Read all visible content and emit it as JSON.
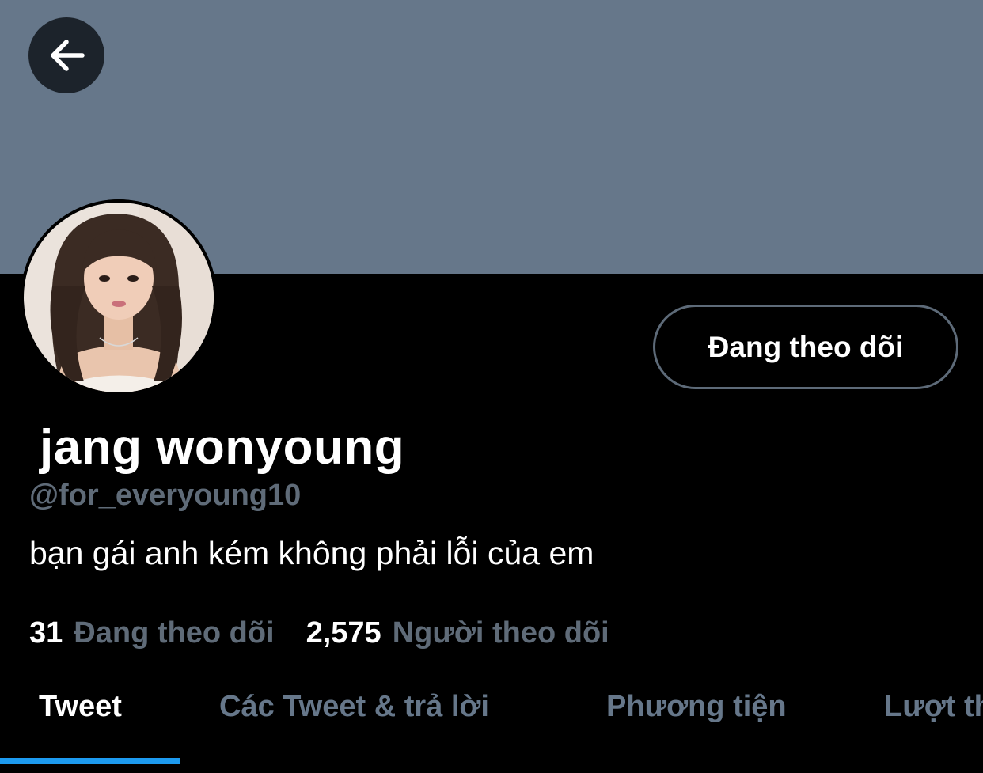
{
  "profile": {
    "display_name": " jang wonyoung",
    "handle": "@for_everyoung10",
    "bio": "bạn gái anh kém không phải lỗi của em",
    "follow_button_label": "Đang theo dõi"
  },
  "stats": {
    "following_count": "31",
    "following_label": "Đang theo dõi",
    "followers_count": "2,575",
    "followers_label": "Người theo dõi"
  },
  "tabs": [
    {
      "label": "Tweet",
      "active": true
    },
    {
      "label": "Các Tweet & trả lời",
      "active": false
    },
    {
      "label": "Phương tiện",
      "active": false
    },
    {
      "label": "Lượt thích",
      "active": false
    }
  ],
  "colors": {
    "banner": "#66778a",
    "background": "#000000",
    "muted_text": "#5f6b78",
    "accent": "#1d9bf0"
  },
  "icons": {
    "back": "arrow-left-icon"
  }
}
